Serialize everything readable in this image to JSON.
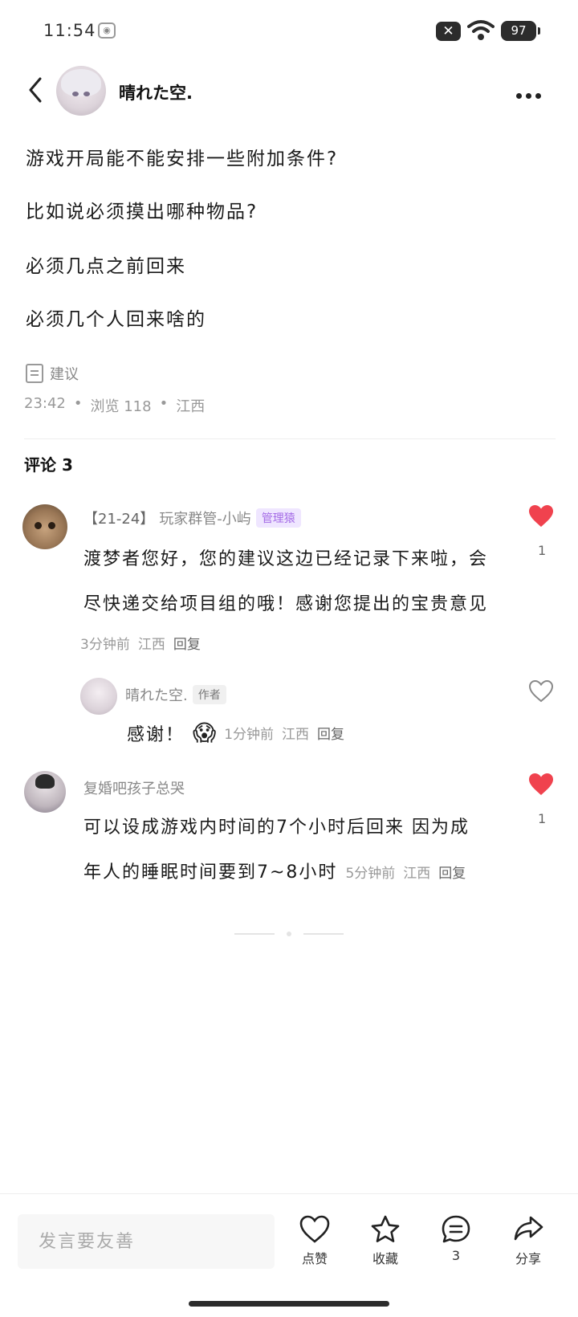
{
  "status_bar": {
    "time": "11:54",
    "battery": "97",
    "close_glyph": "✕",
    "eye_glyph": "◉"
  },
  "header": {
    "author_name": "晴れた空."
  },
  "post": {
    "lines": [
      "游戏开局能不能安排一些附加条件?",
      "比如说必须摸出哪种物品?",
      "必须几点之前回来",
      "必须几个人回来啥的"
    ],
    "tag": "建议",
    "time": "23:42",
    "views": "浏览 118",
    "location": "江西",
    "dot": "•"
  },
  "comments_section": {
    "title": "评论 3"
  },
  "comments": [
    {
      "level": "【21-24】",
      "user": "玩家群管-小屿",
      "badge": "管理猿",
      "text_lines": [
        "渡梦者您好，您的建议这边已经记录下来啦，会",
        "尽快递交给项目组的哦！感谢您提出的宝贵意见"
      ],
      "time": "3分钟前",
      "location": "江西",
      "reply": "回复",
      "likes": "1",
      "liked": true
    },
    {
      "user": "晴れた空.",
      "badge": "作者",
      "text": "感谢！",
      "emoji": "😱",
      "time": "1分钟前",
      "location": "江西",
      "reply": "回复",
      "liked": false
    },
    {
      "user": "复婚吧孩子总哭",
      "text_lines": [
        "可以设成游戏内时间的7个小时后回来   因为成",
        "年人的睡眠时间要到7~8小时"
      ],
      "time": "5分钟前",
      "location": "江西",
      "reply": "回复",
      "likes": "1",
      "liked": true
    }
  ],
  "bottom_bar": {
    "input_placeholder": "发言要友善",
    "like_label": "点赞",
    "favorite_label": "收藏",
    "comment_count": "3",
    "share_label": "分享"
  },
  "colors": {
    "like_red": "#f0424e",
    "admin_badge_text": "#a46be6",
    "admin_badge_bg": "#efe6ff"
  }
}
